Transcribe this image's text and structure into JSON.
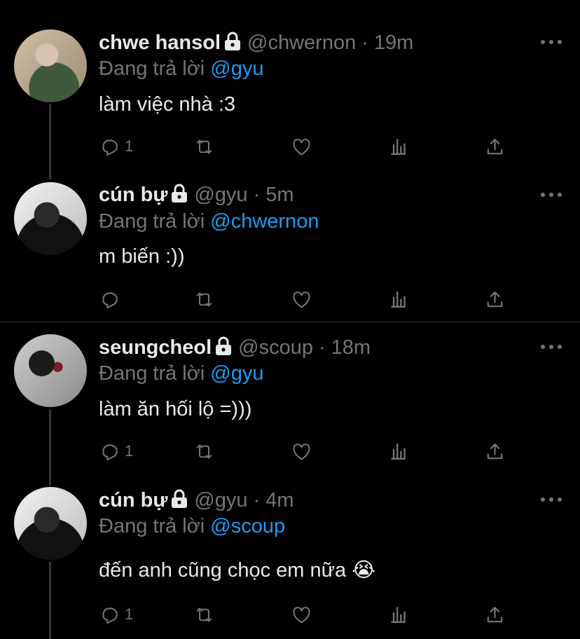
{
  "tweets": [
    {
      "name": "chwe hansol",
      "handle": "@chwernon",
      "time": "19m",
      "reply_prefix": "Đang trả lời",
      "reply_to": "@gyu",
      "text": "làm việc nhà :3",
      "reply_count": "1"
    },
    {
      "name": "cún bự",
      "handle": "@gyu",
      "time": "5m",
      "reply_prefix": "Đang trả lời",
      "reply_to": "@chwernon",
      "text": "m biến :))",
      "reply_count": ""
    },
    {
      "name": "seungcheol",
      "handle": "@scoup",
      "time": "18m",
      "reply_prefix": "Đang trả lời",
      "reply_to": "@gyu",
      "text": "làm ăn hối lộ =)))",
      "reply_count": "1"
    },
    {
      "name": "cún bự",
      "handle": "@gyu",
      "time": "4m",
      "reply_prefix": "Đang trả lời",
      "reply_to": "@scoup",
      "text": "đến anh cũng chọc em nữa 😭",
      "reply_count": "1"
    }
  ],
  "separator": "·",
  "icons": [
    "lock-icon",
    "more-icon",
    "reply-icon",
    "retweet-icon",
    "like-icon",
    "analytics-icon",
    "share-icon"
  ],
  "colors": {
    "background": "#000000",
    "text": "#e7e9ea",
    "muted": "#71767b",
    "mention": "#1d9bf0"
  }
}
